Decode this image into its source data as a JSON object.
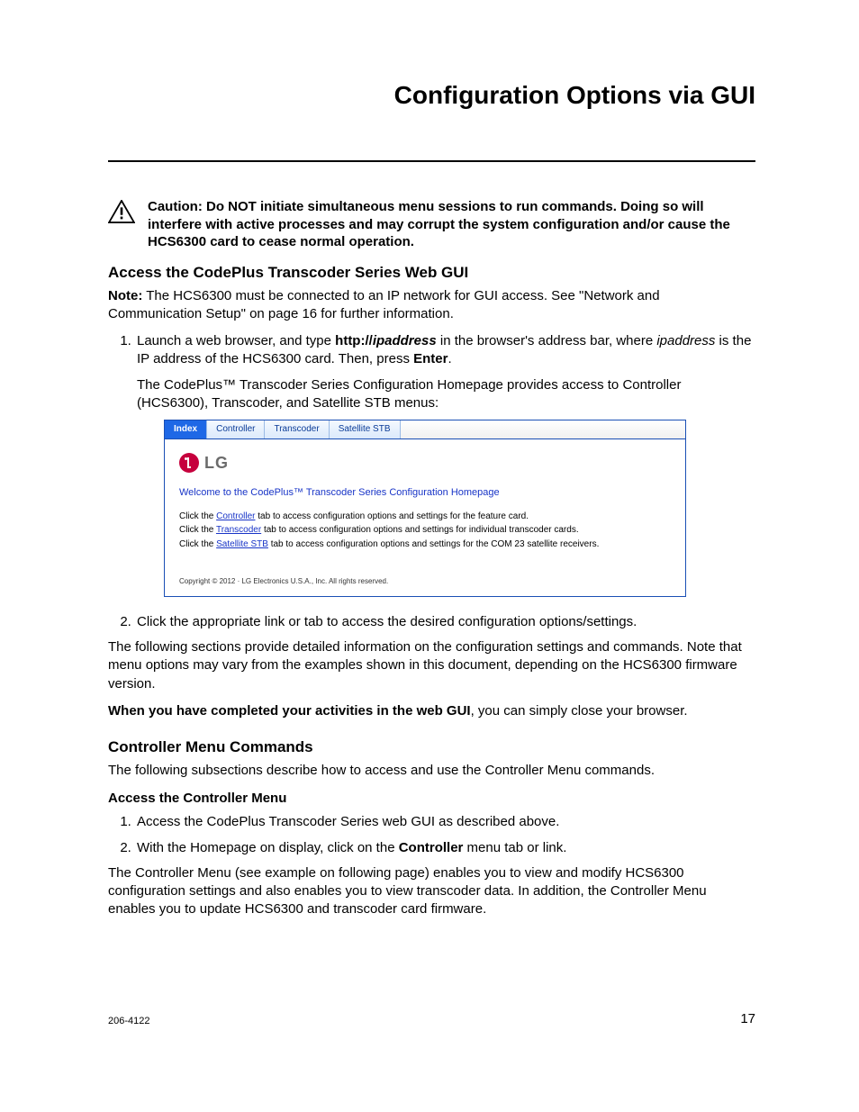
{
  "header": {
    "title": "Configuration Options via GUI"
  },
  "caution": {
    "text": "Caution: Do NOT initiate simultaneous menu sessions to run commands. Doing so will interfere with active processes and may corrupt the system configuration and/or cause the HCS6300 card to cease normal operation."
  },
  "section1": {
    "heading": "Access the CodePlus Transcoder Series Web GUI",
    "note_label": "Note:",
    "note_text": " The HCS6300 must be connected to an IP network for GUI access. See \"Network and Communication Setup\" on page 16 for further information.",
    "step1_a": "Launch a web browser, and type ",
    "step1_b_bold": "http://",
    "step1_b_italic": "ipaddress",
    "step1_c": " in the browser's address bar, where ",
    "step1_d_italic": "ipaddress",
    "step1_e": " is the IP address of the HCS6300 card. Then, press ",
    "step1_f_bold": "Enter",
    "step1_g": ".",
    "step1_sub": "The CodePlus™ Transcoder Series Configuration Homepage provides access to Controller (HCS6300), Transcoder, and Satellite STB menus:",
    "step2": "Click the appropriate link or tab to access the desired configuration options/settings.",
    "para_after": "The following sections provide detailed information on the configuration settings and commands. Note that menu options may vary from the examples shown in this document, depending on the HCS6300 firmware version.",
    "closing_bold": "When you have completed your activities in the web GUI",
    "closing_rest": ", you can simply close your browser."
  },
  "embed": {
    "tabs": [
      "Index",
      "Controller",
      "Transcoder",
      "Satellite STB"
    ],
    "logo_text": "LG",
    "welcome": "Welcome to the CodePlus™ Transcoder Series Configuration Homepage",
    "line1_a": "Click the ",
    "line1_link": "Controller",
    "line1_b": " tab to access configuration options and settings for the feature card.",
    "line2_a": "Click the ",
    "line2_link": "Transcoder",
    "line2_b": " tab to access configuration options and settings for individual transcoder cards.",
    "line3_a": "Click the ",
    "line3_link": "Satellite STB",
    "line3_b": " tab to access configuration options and settings for the COM 23 satellite receivers.",
    "copyright": "Copyright © 2012 · LG Electronics U.S.A., Inc. All rights reserved."
  },
  "section2": {
    "heading": "Controller Menu Commands",
    "intro": "The following subsections describe how to access and use the Controller Menu commands.",
    "sub_heading": "Access the Controller Menu",
    "step1": "Access the CodePlus Transcoder Series web GUI as described above.",
    "step2_a": "With the Homepage on display, click on the ",
    "step2_b_bold": "Controller",
    "step2_c": " menu tab or link.",
    "para_after": "The Controller Menu (see example on following page) enables you to view and modify HCS6300 configuration settings and also enables you to view transcoder data. In addition, the Controller Menu enables you to update HCS6300 and transcoder card firmware."
  },
  "footer": {
    "doc_id": "206-4122",
    "page_num": "17"
  }
}
